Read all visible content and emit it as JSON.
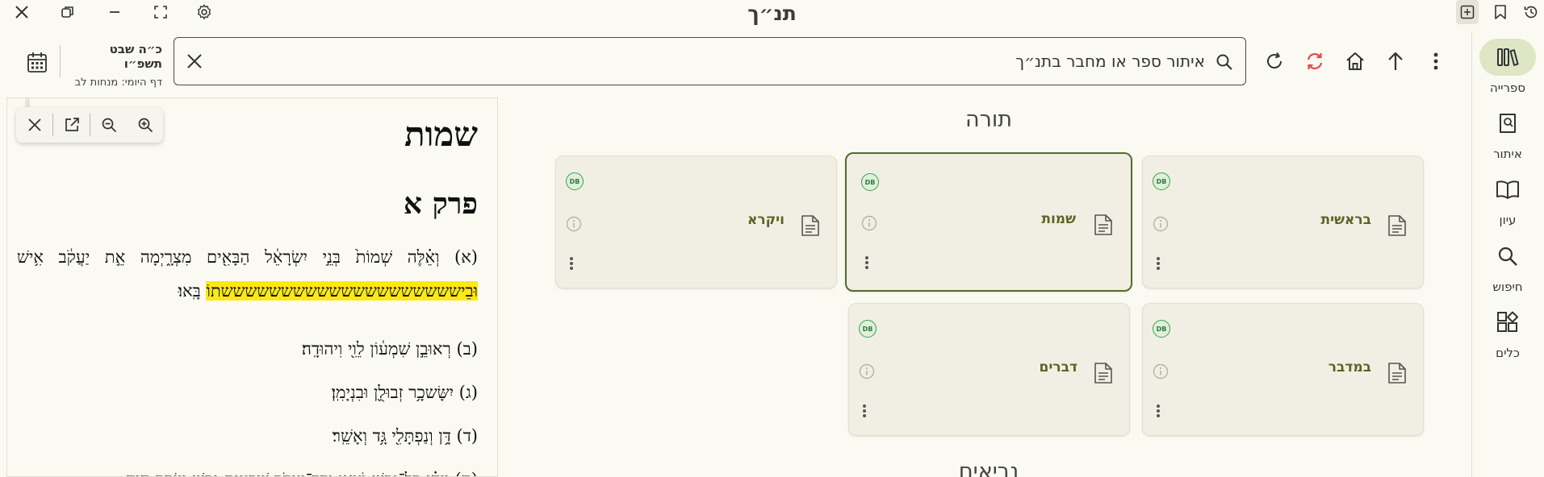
{
  "app": {
    "title": "תנ״ך"
  },
  "toolbar": {
    "date_main": "כ״ה שבט תשפ״ו",
    "date_daf": "דף היומי: מנחות לב",
    "search_placeholder": "איתור ספר או מחבר בתנ״ך"
  },
  "rail": {
    "items": [
      {
        "label": "ספרייה",
        "icon": "library-icon",
        "active": true
      },
      {
        "label": "איתור",
        "icon": "find-book-icon",
        "active": false
      },
      {
        "label": "עיון",
        "icon": "book-open-icon",
        "active": false
      },
      {
        "label": "חיפוש",
        "icon": "search-icon",
        "active": false
      },
      {
        "label": "כלים",
        "icon": "tools-icon",
        "active": false
      }
    ]
  },
  "pane": {
    "book": "שמות",
    "chapter": "פרק א",
    "verses": [
      {
        "num": "(א)",
        "pre": "וְאֵ֗לֶּה שְׁמוֹת֙ בְּנֵ֣י יִשְׂרָאֵ֔ל הַבָּאִ֖ים מִצְרָ֑יְמָה אֵ֣ת יַעֲקֹ֔ב אִ֥ישׁ",
        "highlight": "וּבֵיששששששששששששששששששששתוֹ",
        "post": "בָּֽאוּ׃"
      },
      {
        "num": "(ב)",
        "text": "רְאוּבֵ֣ן שִׁמְע֔וֹן לֵוִ֖י וִיהוּדָֽה׃"
      },
      {
        "num": "(ג)",
        "text": "יִשָּׂשכָ֥ר זְבוּלֻ֖ן וּבִנְיָמִֽן׃"
      },
      {
        "num": "(ד)",
        "text": "דָּ֥ן וְנַפְתָּלִ֖י גָּ֥ד וְאָשֵֽׁר׃"
      },
      {
        "num": "(ה)",
        "text": "וַֽיְהִ֗י כָּל־נֶ֛פֶשׁ יֹצְאֵ֥י יֶֽרֶךְ־יַעֲקֹ֖ב שִׁבְעִ֣ים נָ֑פֶשׁ וְיוֹסֵ֖ף הָיָ֥ה"
      }
    ]
  },
  "categories": [
    {
      "title": "תורה"
    },
    {
      "title": "נביאים"
    }
  ],
  "cards": [
    {
      "name": "בראשית",
      "badge": "DB",
      "selected": false
    },
    {
      "name": "שמות",
      "badge": "DB",
      "selected": true
    },
    {
      "name": "ויקרא",
      "badge": "DB",
      "selected": false
    },
    {
      "name": "במדבר",
      "badge": "DB",
      "selected": false
    },
    {
      "name": "דברים",
      "badge": "DB",
      "selected": false
    }
  ],
  "colors": {
    "accent": "#566b27",
    "highlight": "#fbe816",
    "refresh_red": "#e5484d",
    "badge_green": "#3f9c57"
  }
}
